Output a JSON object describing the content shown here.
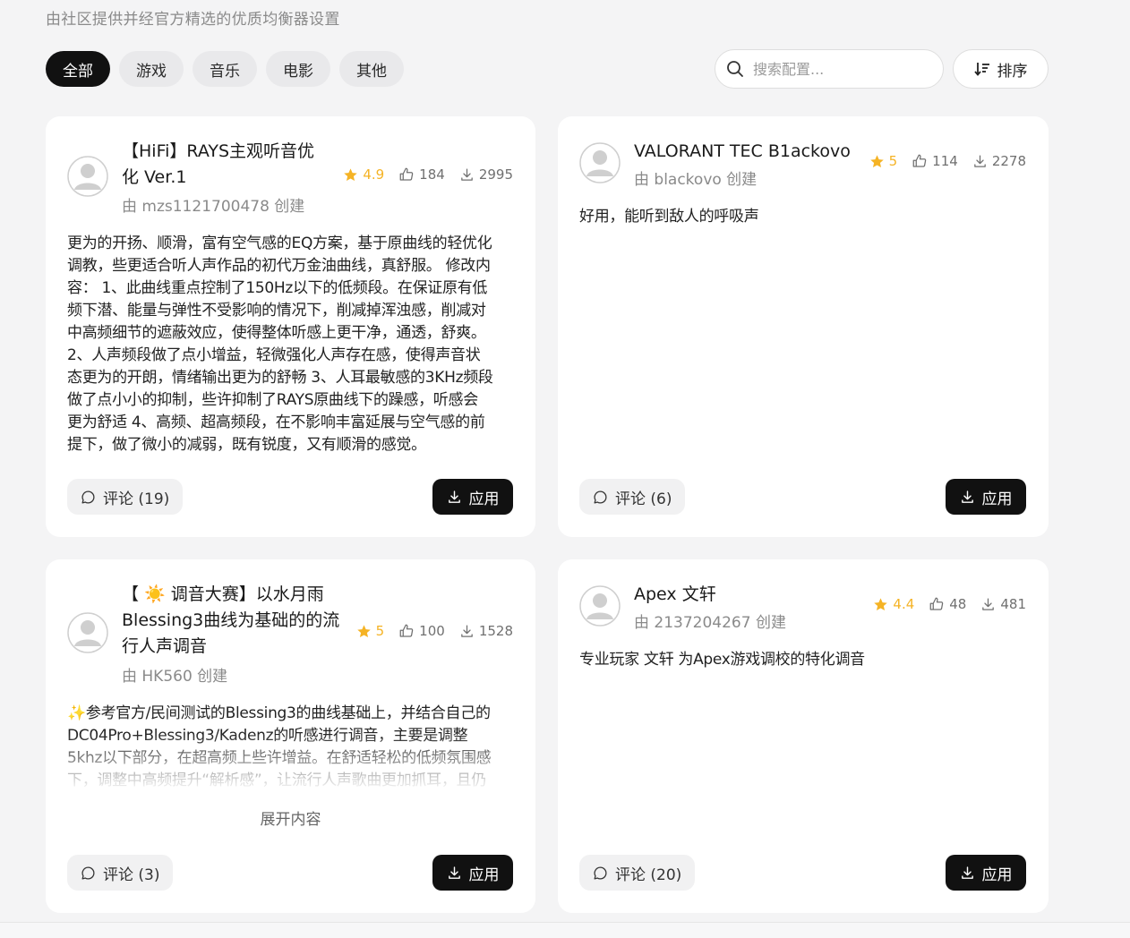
{
  "header": {
    "subtitle": "由社区提供并经官方精选的优质均衡器设置"
  },
  "tabs": [
    {
      "label": "全部",
      "active": true
    },
    {
      "label": "游戏",
      "active": false
    },
    {
      "label": "音乐",
      "active": false
    },
    {
      "label": "电影",
      "active": false
    },
    {
      "label": "其他",
      "active": false
    }
  ],
  "search": {
    "placeholder": "搜索配置...",
    "value": ""
  },
  "sort": {
    "label": "排序"
  },
  "cards": [
    {
      "title_lines": [
        "【HiFi】RAYS主观听音优",
        "化 Ver.1"
      ],
      "creator": "由 mzs1121700478 创建",
      "rating": "4.9",
      "likes": "184",
      "downloads": "2995",
      "description_lines": [
        "更为的开扬、顺滑，富有空气感的EQ方案，基于原曲线的轻优化",
        "调教，些更适合听人声作品的初代万金油曲线，真舒服。 修改内",
        "容： 1、此曲线重点控制了150Hz以下的低频段。在保证原有低",
        "频下潜、能量与弹性不受影响的情况下，削减掉浑浊感，削减对",
        "中高频细节的遮蔽效应，使得整体听感上更干净，通透，舒爽。",
        "2、人声频段做了点小增益，轻微强化人声存在感，使得声音状",
        "态更为的开朗，情绪输出更为的舒畅 3、人耳最敏感的3KHz频段",
        "做了点小小的抑制，些许抑制了RAYS原曲线下的躁感，听感会",
        "更为舒适 4、高频、超高频段，在不影响丰富延展与空气感的前",
        "提下，做了微小的减弱，既有锐度，又有顺滑的感觉。"
      ],
      "comments_label": "评论 (19)",
      "apply_label": "应用"
    },
    {
      "title_lines": [
        "VALORANT TEC B1ackovo"
      ],
      "creator": "由 blackovo 创建",
      "rating": "5",
      "likes": "114",
      "downloads": "2278",
      "description_lines": [
        "好用，能听到敌人的呼吸声"
      ],
      "comments_label": "评论 (6)",
      "apply_label": "应用"
    },
    {
      "title_lines": [
        "【 ☀️ 调音大赛】以水月雨",
        "Blessing3曲线为基础的的流",
        "行人声调音"
      ],
      "creator": "由 HK560 创建",
      "rating": "5",
      "likes": "100",
      "downloads": "1528",
      "description_lines": [
        "✨参考官方/民间测试的Blessing3的曲线基础上，并结合自己的",
        "DC04Pro+Blessing3/Kadenz的听感进行调音，主要是调整",
        "5khz以下部分，在超高频上些许增益。在舒适轻松的低频氛围感",
        "下，调整中高频提升“解析感”，让流行人声歌曲更加抓耳，且仍"
      ],
      "expand_label": "展开内容",
      "comments_label": "评论 (3)",
      "apply_label": "应用"
    },
    {
      "title_lines": [
        "Apex 文轩"
      ],
      "creator": "由 2137204267 创建",
      "rating": "4.4",
      "likes": "48",
      "downloads": "481",
      "description_lines": [
        "专业玩家 文轩 为Apex游戏调校的特化调音"
      ],
      "comments_label": "评论 (20)",
      "apply_label": "应用"
    }
  ],
  "colors": {
    "background": "#f4f4f5",
    "card": "#ffffff",
    "accent_dark": "#111111",
    "star": "#f5b325",
    "muted_text": "#8a8a8a"
  }
}
